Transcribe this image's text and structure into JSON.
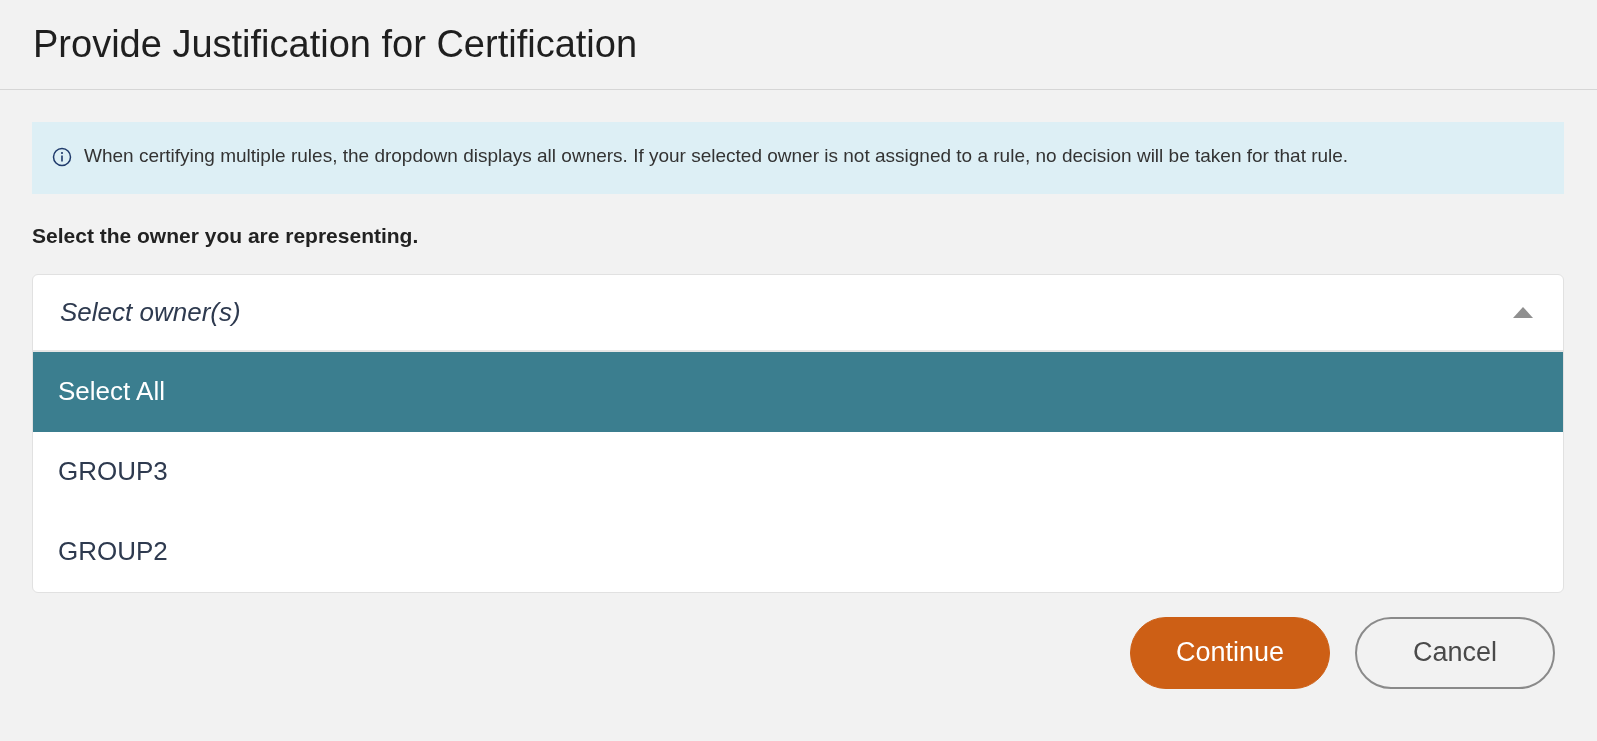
{
  "dialog": {
    "title": "Provide Justification for Certification"
  },
  "info": {
    "text": "When certifying multiple rules, the dropdown displays all owners. If your selected owner is not assigned to a rule, no decision will be taken for that rule."
  },
  "field_label": "Select the owner you are representing.",
  "dropdown": {
    "placeholder": "Select owner(s)",
    "expanded": true,
    "options": [
      {
        "label": "Select All",
        "selected": true
      },
      {
        "label": "GROUP3",
        "selected": false
      },
      {
        "label": "GROUP2",
        "selected": false
      }
    ]
  },
  "buttons": [
    {
      "label": "Continue",
      "kind": "primary"
    },
    {
      "label": "Cancel",
      "kind": "secondary"
    }
  ]
}
